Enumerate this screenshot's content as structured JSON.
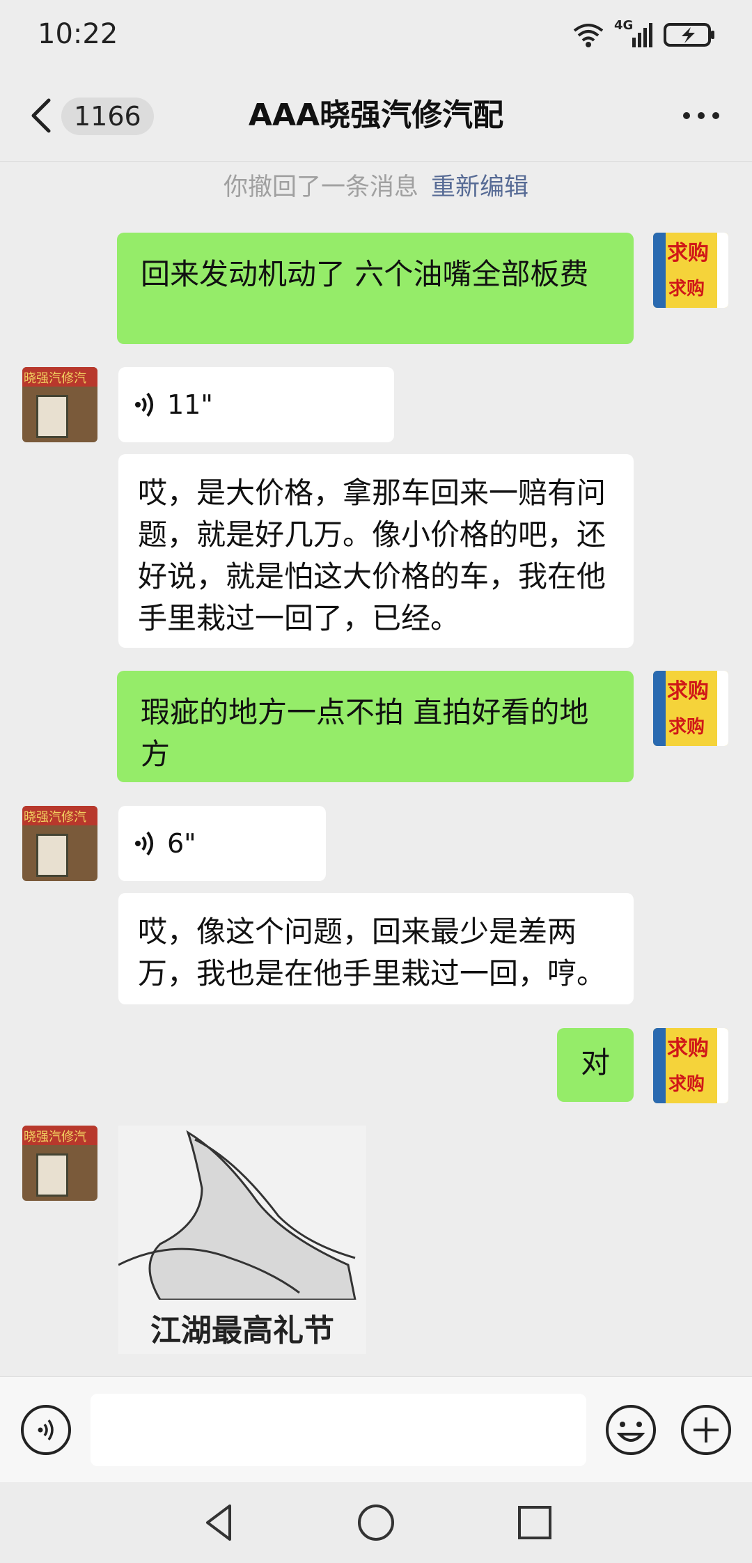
{
  "status_bar": {
    "time": "10:22",
    "network": "4G"
  },
  "header": {
    "unread_count": "1166",
    "title": "AAA晓强汽修汽配"
  },
  "recall_notice": {
    "text": "你撤回了一条消息",
    "action": "重新编辑"
  },
  "messages": [
    {
      "sender": "me",
      "type": "text",
      "text": "回来发动机动了 六个油嘴全部板费"
    },
    {
      "sender": "them",
      "type": "voice",
      "duration": "11\""
    },
    {
      "sender": "them",
      "type": "text",
      "text": "哎，是大价格，拿那车回来一赔有问题，就是好几万。像小价格的吧，还好说，就是怕这大价格的车，我在他手里栽过一回了，已经。"
    },
    {
      "sender": "me",
      "type": "text",
      "text": "瑕疵的地方一点不拍 直拍好看的地方"
    },
    {
      "sender": "them",
      "type": "voice",
      "duration": "6\""
    },
    {
      "sender": "them",
      "type": "text",
      "text": "哎，像这个问题，回来最少是差两万，我也是在他手里栽过一回，哼。"
    },
    {
      "sender": "me",
      "type": "text",
      "text": "对"
    },
    {
      "sender": "them",
      "type": "sticker",
      "caption": "江湖最高礼节"
    }
  ],
  "avatars": {
    "me_sign_text_1": "求购",
    "me_sign_text_2": "求购",
    "them_shop_sign": "晓强汽修汽"
  },
  "input_bar": {
    "placeholder": ""
  },
  "colors": {
    "my_bubble": "#95ec69",
    "their_bubble": "#ffffff",
    "link": "#576b95",
    "background": "#ededed"
  }
}
